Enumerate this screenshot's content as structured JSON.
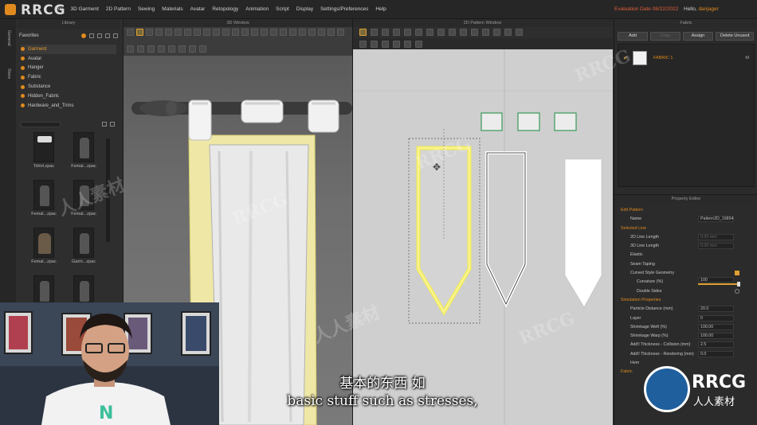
{
  "app": {
    "brand": "RRCG",
    "menu": [
      "File",
      "3D Garment",
      "2D Pattern",
      "Sewing",
      "Materials",
      "Avatar",
      "Retopology",
      "Animation",
      "Script",
      "Display",
      "Settings/Preferences",
      "Help"
    ],
    "evaluation": "Evaluation Date 08/22/2022",
    "greeting": "Hello,",
    "username": "danjager"
  },
  "library": {
    "title": "Library",
    "side_tabs": [
      "General",
      "Store"
    ],
    "favorites_label": "Favorites",
    "tree": [
      "Garment",
      "Avatar",
      "Hanger",
      "Fabric",
      "Substance",
      "Hidden_Fabric",
      "Hardware_and_Trims"
    ],
    "active_item": "Garment",
    "items": [
      {
        "label": "Tshirt.zpac",
        "kind": "tshirt"
      },
      {
        "label": "Femal...zpac",
        "kind": "plain"
      },
      {
        "label": "Femal...zpac",
        "kind": "plain"
      },
      {
        "label": "Femal...zpac",
        "kind": "plain"
      },
      {
        "label": "Femal...zpac",
        "kind": "dress"
      },
      {
        "label": "Garm...zpac",
        "kind": "plain"
      },
      {
        "label": "Garm...zpac",
        "kind": "plain"
      },
      {
        "label": "Garm...zpac",
        "kind": "plain"
      }
    ]
  },
  "window3d": {
    "title": "3D Window"
  },
  "window2d": {
    "title": "2D Pattern Window"
  },
  "fabric": {
    "title": "Fabric",
    "buttons": [
      "Add",
      "Copy",
      "Assign",
      "Delete Unused"
    ],
    "item_name": "FABRIC 1",
    "item_mark": "M"
  },
  "property_editor": {
    "title": "Property Editor",
    "rows": [
      {
        "label": "Edit Pattern",
        "type": "section",
        "indent": 0
      },
      {
        "label": "Name",
        "value": "Pattern2D_16894",
        "type": "value",
        "indent": 8
      },
      {
        "label": "Selected Line",
        "type": "section",
        "indent": 0
      },
      {
        "label": "2D Line Length",
        "value": "0.00 mm",
        "type": "dimvalue",
        "indent": 8
      },
      {
        "label": "3D Line Length",
        "value": "0.00 mm",
        "type": "dimvalue",
        "indent": 8
      },
      {
        "label": "Elastic",
        "type": "plain",
        "indent": 8
      },
      {
        "label": "Seam Taping",
        "type": "plain",
        "indent": 8
      },
      {
        "label": "Curved Style Geometry",
        "type": "check",
        "indent": 8
      },
      {
        "label": "Curvature (%)",
        "value": "100",
        "type": "slider",
        "indent": 16
      },
      {
        "label": "Double Sides",
        "type": "toggle",
        "indent": 16
      },
      {
        "label": "Simulation Properties",
        "type": "section",
        "indent": 0
      },
      {
        "label": "Particle Distance (mm)",
        "value": "20.0",
        "type": "value",
        "indent": 8
      },
      {
        "label": "Layer",
        "value": "0",
        "type": "value",
        "indent": 8
      },
      {
        "label": "Shrinkage Weft (%)",
        "value": "100.00",
        "type": "value",
        "indent": 8
      },
      {
        "label": "Shrinkage Warp (%)",
        "value": "100.00",
        "type": "value",
        "indent": 8
      },
      {
        "label": "Add'l Thickness - Collision (mm)",
        "value": "2.5",
        "type": "value",
        "indent": 8
      },
      {
        "label": "Add'l Thickness - Rendering (mm)",
        "value": "0.0",
        "type": "value",
        "indent": 8
      },
      {
        "label": "Hem",
        "type": "plain",
        "indent": 8
      },
      {
        "label": "Fabric",
        "type": "section",
        "indent": 0
      }
    ]
  },
  "subtitles": {
    "zh": "基本的东西 如",
    "en": "basic stuff such as stresses,"
  },
  "watermark": {
    "badge_text": "RRCG",
    "badge_sub": "人人素材",
    "repeat_text": "RRCG",
    "repeat_text_cn": "人人素材"
  },
  "colors": {
    "accent": "#e08a1e",
    "selection": "#e8e060",
    "seam_green": "#3a9a5a",
    "badge_blue": "#1f5f9e"
  }
}
